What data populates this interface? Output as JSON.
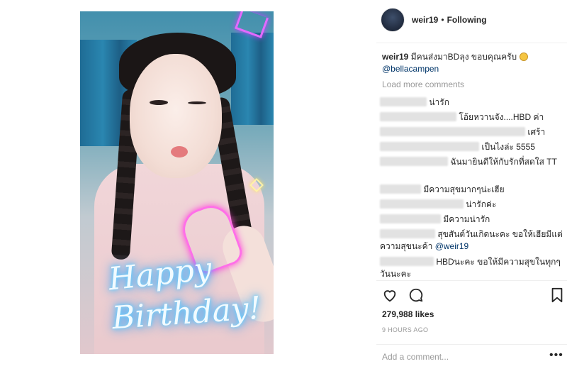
{
  "post": {
    "username": "weir19",
    "follow_status": "Following",
    "caption_user": "weir19",
    "caption_text": " มีคนส่งมาBDลุง ขอบคุณครับ",
    "caption_mention": "@bellacampen",
    "photo_overlay": {
      "line1": "Happy",
      "line2": "Birthday!"
    }
  },
  "comments": {
    "load_more": "Load more comments",
    "items": [
      {
        "text": "น่ารัก"
      },
      {
        "text": "โอ้ยหวานจัง....HBD ค่า"
      },
      {
        "text": "เศร้า"
      },
      {
        "text": "เป็นไงล่ะ 5555"
      },
      {
        "text": "ฉันมายินดีให้กับรักที่สดใส TT"
      },
      {
        "text": "มีความสุขมากๆน่ะเฮีย"
      },
      {
        "text": "น่ารักค่ะ"
      },
      {
        "text": "มีความน่ารัก"
      },
      {
        "text": "สุขสันต์วันเกิดนะคะ ขอให้เฮียมีแต่ความสุขนะค้า",
        "mention": "@weir19"
      },
      {
        "text": "HBDนะคะ ขอให้มีความสุขในทุกๆวันนะคะ"
      }
    ]
  },
  "stats": {
    "likes": "279,988 likes",
    "time_ago": "9 HOURS AGO"
  },
  "add_comment": {
    "placeholder": "Add a comment..."
  },
  "icons": {
    "like": "heart-icon",
    "comment": "comment-bubble-icon",
    "save": "bookmark-icon",
    "more": "more-dots-icon"
  }
}
